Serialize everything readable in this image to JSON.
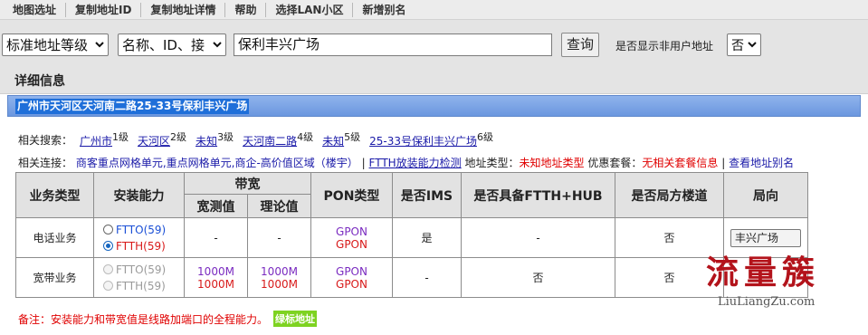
{
  "menu": [
    "地图选址",
    "复制地址ID",
    "复制地址详情",
    "帮助",
    "选择LAN小区",
    "新增别名"
  ],
  "search": {
    "level_select": "标准地址等级",
    "field_select": "名称、ID、接",
    "query_value": "保利丰兴广场",
    "query_button": "查询",
    "nonuser_label": "是否显示非用户地址",
    "nonuser_select": "否"
  },
  "detail": {
    "title": "详细信息",
    "address": "广州市天河区天河南二路25-33号保利丰兴广场"
  },
  "related_search": {
    "label": "相关搜索：",
    "crumbs": [
      {
        "name": "广州市",
        "level": "1级"
      },
      {
        "name": "天河区",
        "level": "2级"
      },
      {
        "name": "未知",
        "level": "3级"
      },
      {
        "name": "天河南二路",
        "level": "4级"
      },
      {
        "name": "未知",
        "level": "5级"
      },
      {
        "name": "25-33号保利丰兴广场",
        "level": "6级"
      }
    ]
  },
  "related_link": {
    "label": "相关连接：",
    "grid_units": "商客重点网格单元,重点网格单元,商企-高价值区域（楼宇）",
    "sep1": "|",
    "ftth_link": "FTTH放装能力检测",
    "addr_type_label": "地址类型：",
    "addr_type_value": "未知地址类型",
    "package_label": "优惠套餐：",
    "package_value": "无相关套餐信息",
    "sep2": "|",
    "alias_link": "查看地址别名"
  },
  "table": {
    "headers": {
      "business": "业务类型",
      "install": "安装能力",
      "bandwidth": "带宽",
      "bw_measured": "宽测值",
      "bw_theory": "理论值",
      "pon": "PON类型",
      "ims": "是否IMS",
      "ftth_hub": "是否具备FTTH+HUB",
      "bureau": "是否局方楼道",
      "direction": "局向"
    },
    "rows": [
      {
        "business": "电话业务",
        "opt1": "FTTO(59)",
        "opt2": "FTTH(59)",
        "bw_measured": "-",
        "bw_theory": "-",
        "pon1": "GPON",
        "pon2": "GPON",
        "ims": "是",
        "ftth_hub": "-",
        "bureau": "否",
        "direction": "丰兴广场"
      },
      {
        "business": "宽带业务",
        "opt1": "FTTO(59)",
        "opt2": "FTTH(59)",
        "bw_measured1": "1000M",
        "bw_measured2": "1000M",
        "bw_theory1": "1000M",
        "bw_theory2": "1000M",
        "pon1": "GPON",
        "pon2": "GPON",
        "ims": "-",
        "ftth_hub": "否",
        "bureau": "否",
        "direction": ""
      }
    ]
  },
  "note": {
    "text": "备注：安装能力和带宽值是线路加端口的全程能力。",
    "tag": "绿标地址"
  },
  "watermark": {
    "title": "流量簇",
    "sub": "LiuLiangZu.com"
  },
  "colors": {
    "accent_blue": "#1f6fd9",
    "link": "#1a1aa8",
    "alert_red": "#e00000",
    "pon_purple": "#7a2bc0",
    "tag_green": "#7ed321",
    "watermark_red": "#b3131b"
  }
}
